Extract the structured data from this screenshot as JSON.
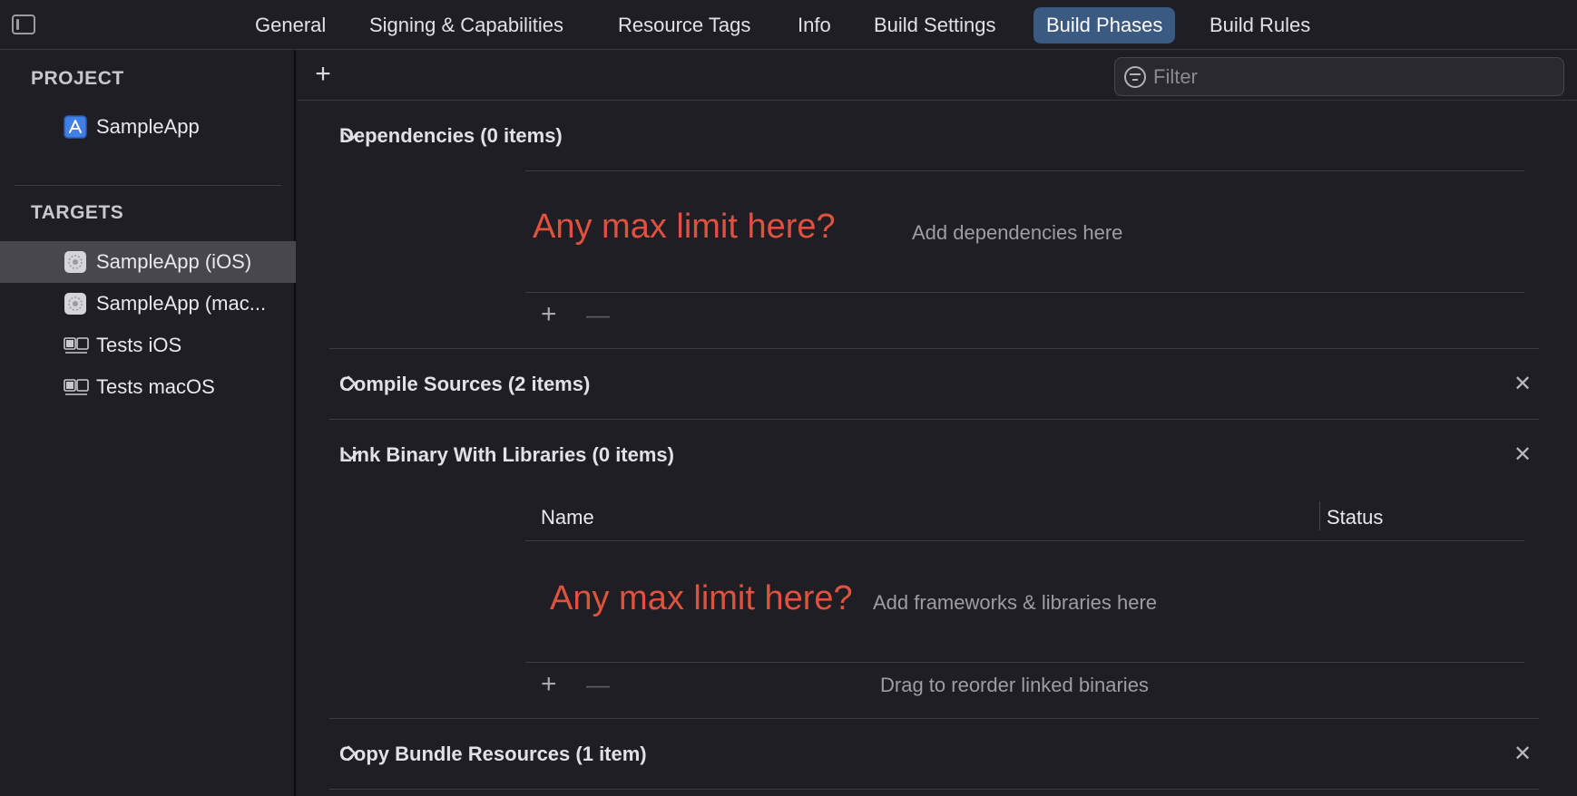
{
  "tabs": [
    {
      "label": "General"
    },
    {
      "label": "Signing & Capabilities"
    },
    {
      "label": "Resource Tags"
    },
    {
      "label": "Info"
    },
    {
      "label": "Build Settings"
    },
    {
      "label": "Build Phases",
      "active": true
    },
    {
      "label": "Build Rules"
    }
  ],
  "sidebar": {
    "project_heading": "PROJECT",
    "project_item": "SampleApp",
    "targets_heading": "TARGETS",
    "targets": [
      {
        "label": "SampleApp (iOS)",
        "icon": "app-target-icon",
        "selected": true
      },
      {
        "label": "SampleApp (mac...",
        "icon": "app-target-icon",
        "selected": false
      },
      {
        "label": "Tests iOS",
        "icon": "test-bundle-icon",
        "selected": false
      },
      {
        "label": "Tests macOS",
        "icon": "test-bundle-icon",
        "selected": false
      }
    ]
  },
  "toolbar": {
    "add_label": "+",
    "filter_placeholder": "Filter"
  },
  "phases": {
    "dependencies": {
      "title": "Dependencies (0 items)",
      "note": "Any max limit here?",
      "hint": "Add dependencies here",
      "plus": "+",
      "minus": "—"
    },
    "compile_sources": {
      "title": "Compile Sources (2 items)"
    },
    "link_binary": {
      "title": "Link Binary With Libraries (0 items)",
      "col_name": "Name",
      "col_status": "Status",
      "note": "Any max limit here?",
      "hint": "Add frameworks & libraries here",
      "reorder_hint": "Drag to reorder linked binaries",
      "plus": "+",
      "minus": "—"
    },
    "copy_bundle": {
      "title": "Copy Bundle Resources (1 item)"
    },
    "close_glyph": "✕"
  },
  "colors": {
    "accent_tab": "#3a5a82",
    "annotation_red": "#e0523e",
    "background": "#1f1e25"
  }
}
